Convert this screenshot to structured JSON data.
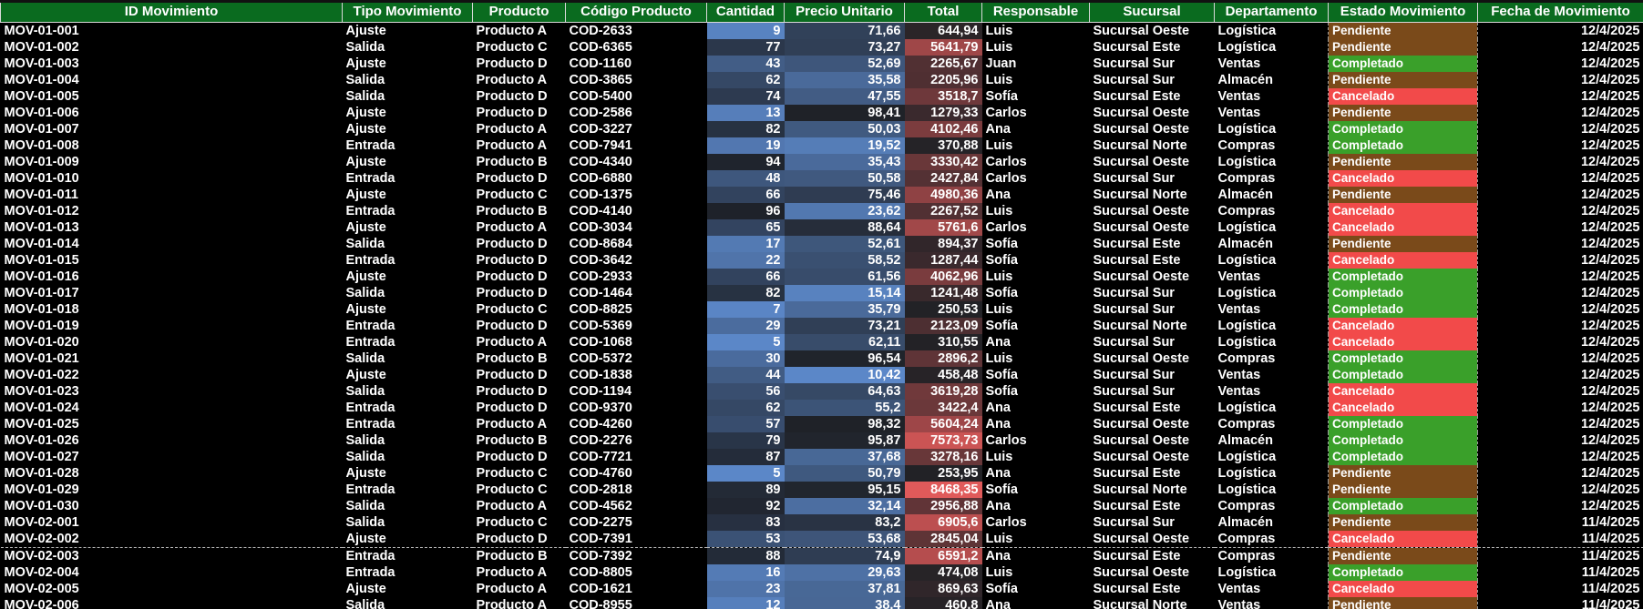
{
  "columns": [
    "ID Movimiento",
    "Tipo Movimiento",
    "Producto",
    "Código Producto",
    "Cantidad",
    "Precio Unitario",
    "Total",
    "Responsable",
    "Sucursal",
    "Departamento",
    "Estado Movimiento",
    "Fecha de Movimiento"
  ],
  "colors": {
    "header_bg": "#0a6b1f",
    "status_pendiente": "#7a4a1a",
    "status_completado": "#3aa02a",
    "status_cancelado": "#f24a4a"
  },
  "rows": [
    [
      "MOV-01-001",
      "Ajuste",
      "Producto A",
      "COD-2633",
      "9",
      "71,66",
      "644,94",
      "Luis",
      "Sucursal Oeste",
      "Logística",
      "Pendiente",
      "12/4/2025"
    ],
    [
      "MOV-01-002",
      "Salida",
      "Producto C",
      "COD-6365",
      "77",
      "73,27",
      "5641,79",
      "Luis",
      "Sucursal Este",
      "Logística",
      "Pendiente",
      "12/4/2025"
    ],
    [
      "MOV-01-003",
      "Ajuste",
      "Producto D",
      "COD-1160",
      "43",
      "52,69",
      "2265,67",
      "Juan",
      "Sucursal Sur",
      "Ventas",
      "Completado",
      "12/4/2025"
    ],
    [
      "MOV-01-004",
      "Salida",
      "Producto A",
      "COD-3865",
      "62",
      "35,58",
      "2205,96",
      "Luis",
      "Sucursal Sur",
      "Almacén",
      "Pendiente",
      "12/4/2025"
    ],
    [
      "MOV-01-005",
      "Salida",
      "Producto D",
      "COD-5400",
      "74",
      "47,55",
      "3518,7",
      "Sofía",
      "Sucursal Este",
      "Ventas",
      "Cancelado",
      "12/4/2025"
    ],
    [
      "MOV-01-006",
      "Ajuste",
      "Producto D",
      "COD-2586",
      "13",
      "98,41",
      "1279,33",
      "Carlos",
      "Sucursal Oeste",
      "Ventas",
      "Pendiente",
      "12/4/2025"
    ],
    [
      "MOV-01-007",
      "Ajuste",
      "Producto A",
      "COD-3227",
      "82",
      "50,03",
      "4102,46",
      "Ana",
      "Sucursal Oeste",
      "Logística",
      "Completado",
      "12/4/2025"
    ],
    [
      "MOV-01-008",
      "Entrada",
      "Producto A",
      "COD-7941",
      "19",
      "19,52",
      "370,88",
      "Luis",
      "Sucursal Norte",
      "Compras",
      "Completado",
      "12/4/2025"
    ],
    [
      "MOV-01-009",
      "Ajuste",
      "Producto B",
      "COD-4340",
      "94",
      "35,43",
      "3330,42",
      "Carlos",
      "Sucursal Oeste",
      "Logística",
      "Pendiente",
      "12/4/2025"
    ],
    [
      "MOV-01-010",
      "Entrada",
      "Producto D",
      "COD-6880",
      "48",
      "50,58",
      "2427,84",
      "Carlos",
      "Sucursal Sur",
      "Compras",
      "Cancelado",
      "12/4/2025"
    ],
    [
      "MOV-01-011",
      "Ajuste",
      "Producto C",
      "COD-1375",
      "66",
      "75,46",
      "4980,36",
      "Ana",
      "Sucursal Norte",
      "Almacén",
      "Pendiente",
      "12/4/2025"
    ],
    [
      "MOV-01-012",
      "Entrada",
      "Producto B",
      "COD-4140",
      "96",
      "23,62",
      "2267,52",
      "Luis",
      "Sucursal Oeste",
      "Compras",
      "Cancelado",
      "12/4/2025"
    ],
    [
      "MOV-01-013",
      "Ajuste",
      "Producto A",
      "COD-3034",
      "65",
      "88,64",
      "5761,6",
      "Carlos",
      "Sucursal Oeste",
      "Logística",
      "Cancelado",
      "12/4/2025"
    ],
    [
      "MOV-01-014",
      "Salida",
      "Producto D",
      "COD-8684",
      "17",
      "52,61",
      "894,37",
      "Sofía",
      "Sucursal Este",
      "Almacén",
      "Pendiente",
      "12/4/2025"
    ],
    [
      "MOV-01-015",
      "Entrada",
      "Producto D",
      "COD-3642",
      "22",
      "58,52",
      "1287,44",
      "Sofía",
      "Sucursal Este",
      "Logística",
      "Cancelado",
      "12/4/2025"
    ],
    [
      "MOV-01-016",
      "Ajuste",
      "Producto D",
      "COD-2933",
      "66",
      "61,56",
      "4062,96",
      "Luis",
      "Sucursal Oeste",
      "Ventas",
      "Completado",
      "12/4/2025"
    ],
    [
      "MOV-01-017",
      "Salida",
      "Producto D",
      "COD-1464",
      "82",
      "15,14",
      "1241,48",
      "Sofía",
      "Sucursal Sur",
      "Logística",
      "Completado",
      "12/4/2025"
    ],
    [
      "MOV-01-018",
      "Ajuste",
      "Producto C",
      "COD-8825",
      "7",
      "35,79",
      "250,53",
      "Luis",
      "Sucursal Sur",
      "Ventas",
      "Completado",
      "12/4/2025"
    ],
    [
      "MOV-01-019",
      "Entrada",
      "Producto D",
      "COD-5369",
      "29",
      "73,21",
      "2123,09",
      "Sofía",
      "Sucursal Norte",
      "Logística",
      "Cancelado",
      "12/4/2025"
    ],
    [
      "MOV-01-020",
      "Entrada",
      "Producto A",
      "COD-1068",
      "5",
      "62,11",
      "310,55",
      "Ana",
      "Sucursal Sur",
      "Logística",
      "Cancelado",
      "12/4/2025"
    ],
    [
      "MOV-01-021",
      "Salida",
      "Producto B",
      "COD-5372",
      "30",
      "96,54",
      "2896,2",
      "Luis",
      "Sucursal Oeste",
      "Compras",
      "Completado",
      "12/4/2025"
    ],
    [
      "MOV-01-022",
      "Ajuste",
      "Producto D",
      "COD-1838",
      "44",
      "10,42",
      "458,48",
      "Sofía",
      "Sucursal Sur",
      "Ventas",
      "Completado",
      "12/4/2025"
    ],
    [
      "MOV-01-023",
      "Salida",
      "Producto D",
      "COD-1194",
      "56",
      "64,63",
      "3619,28",
      "Sofía",
      "Sucursal Sur",
      "Ventas",
      "Cancelado",
      "12/4/2025"
    ],
    [
      "MOV-01-024",
      "Entrada",
      "Producto D",
      "COD-9370",
      "62",
      "55,2",
      "3422,4",
      "Ana",
      "Sucursal Este",
      "Logística",
      "Cancelado",
      "12/4/2025"
    ],
    [
      "MOV-01-025",
      "Entrada",
      "Producto A",
      "COD-4260",
      "57",
      "98,32",
      "5604,24",
      "Ana",
      "Sucursal Oeste",
      "Compras",
      "Completado",
      "12/4/2025"
    ],
    [
      "MOV-01-026",
      "Salida",
      "Producto B",
      "COD-2276",
      "79",
      "95,87",
      "7573,73",
      "Carlos",
      "Sucursal Oeste",
      "Almacén",
      "Completado",
      "12/4/2025"
    ],
    [
      "MOV-01-027",
      "Salida",
      "Producto D",
      "COD-7721",
      "87",
      "37,68",
      "3278,16",
      "Luis",
      "Sucursal Oeste",
      "Logística",
      "Completado",
      "12/4/2025"
    ],
    [
      "MOV-01-028",
      "Ajuste",
      "Producto C",
      "COD-4760",
      "5",
      "50,79",
      "253,95",
      "Ana",
      "Sucursal Este",
      "Logística",
      "Pendiente",
      "12/4/2025"
    ],
    [
      "MOV-01-029",
      "Entrada",
      "Producto C",
      "COD-2818",
      "89",
      "95,15",
      "8468,35",
      "Sofía",
      "Sucursal Norte",
      "Logística",
      "Pendiente",
      "12/4/2025"
    ],
    [
      "MOV-01-030",
      "Salida",
      "Producto A",
      "COD-4562",
      "92",
      "32,14",
      "2956,88",
      "Ana",
      "Sucursal Este",
      "Compras",
      "Completado",
      "12/4/2025"
    ],
    [
      "MOV-02-001",
      "Salida",
      "Producto C",
      "COD-2275",
      "83",
      "83,2",
      "6905,6",
      "Carlos",
      "Sucursal Sur",
      "Almacén",
      "Pendiente",
      "11/4/2025"
    ],
    [
      "MOV-02-002",
      "Ajuste",
      "Producto D",
      "COD-7391",
      "53",
      "53,68",
      "2845,04",
      "Luis",
      "Sucursal Oeste",
      "Compras",
      "Cancelado",
      "11/4/2025"
    ],
    [
      "MOV-02-003",
      "Entrada",
      "Producto B",
      "COD-7392",
      "88",
      "74,9",
      "6591,2",
      "Ana",
      "Sucursal Este",
      "Compras",
      "Pendiente",
      "11/4/2025"
    ],
    [
      "MOV-02-004",
      "Entrada",
      "Producto A",
      "COD-8805",
      "16",
      "29,63",
      "474,08",
      "Luis",
      "Sucursal Oeste",
      "Logística",
      "Completado",
      "11/4/2025"
    ],
    [
      "MOV-02-005",
      "Ajuste",
      "Producto A",
      "COD-1621",
      "23",
      "37,81",
      "869,63",
      "Sofía",
      "Sucursal Este",
      "Ventas",
      "Cancelado",
      "11/4/2025"
    ],
    [
      "MOV-02-006",
      "Salida",
      "Producto A",
      "COD-8955",
      "12",
      "38,4",
      "460,8",
      "Ana",
      "Sucursal Norte",
      "Ventas",
      "Pendiente",
      "11/4/2025"
    ]
  ]
}
